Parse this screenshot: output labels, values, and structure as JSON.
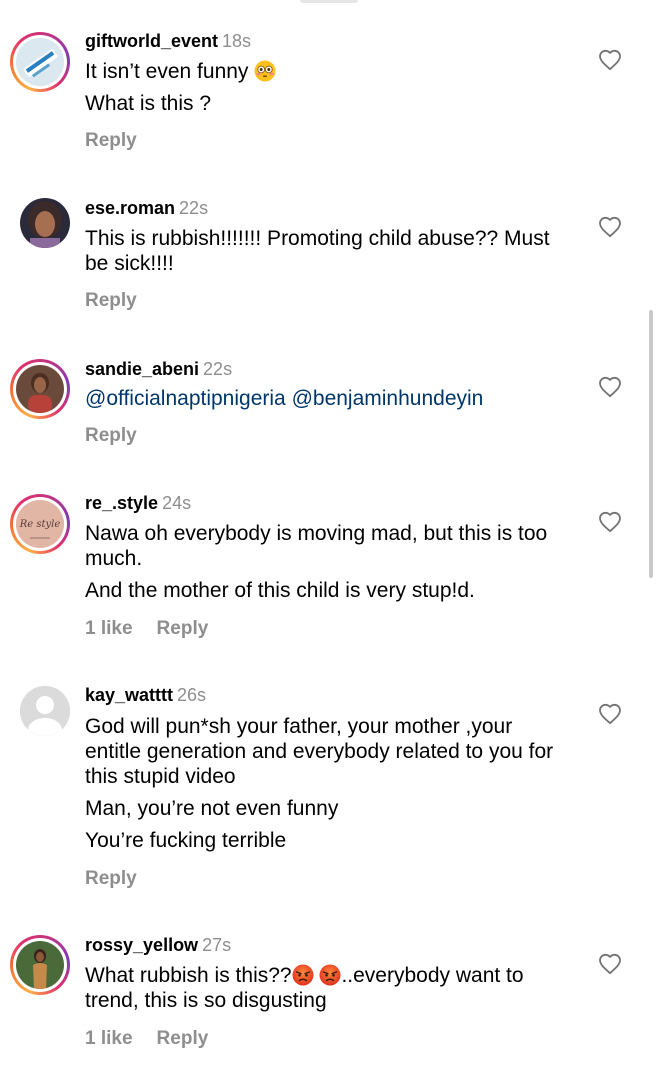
{
  "comments": [
    {
      "username": "giftworld_event",
      "time": "18s",
      "lines": [
        "It isn’t even funny",
        "What is this ?"
      ],
      "emoji": "flushed-face",
      "likes": "",
      "reply_label": "Reply"
    },
    {
      "username": "ese.roman",
      "time": "22s",
      "lines": [
        "This is rubbish!!!!!!! Promoting child abuse?? Must be sick!!!!"
      ],
      "likes": "",
      "reply_label": "Reply"
    },
    {
      "username": "sandie_abeni",
      "time": "22s",
      "mentions": [
        "@officialnaptipnigeria",
        "@benjaminhundeyin"
      ],
      "likes": "",
      "reply_label": "Reply"
    },
    {
      "username": "re_.style",
      "time": "24s",
      "lines": [
        "Nawa oh everybody is moving mad, but this is too much.",
        "And the mother of this child is very stup!d."
      ],
      "likes": "1 like",
      "reply_label": "Reply",
      "avatar_text": "Re style"
    },
    {
      "username": "kay_watttt",
      "time": "26s",
      "lines": [
        "God will pun*sh your father, your mother ,your entitle generation and everybody related to you for this stupid video",
        "Man, you’re not even funny",
        "You’re fucking terrible"
      ],
      "likes": "",
      "reply_label": "Reply"
    },
    {
      "username": "rossy_yellow",
      "time": "27s",
      "text_before": "What rubbish is this??",
      "emoji": "angry-face",
      "text_after": "..everybody want to trend, this is so disgusting",
      "likes": "1 like",
      "reply_label": "Reply"
    }
  ],
  "colors": {
    "username": "#000000",
    "secondary": "#8e8e8e",
    "mention": "#00376b",
    "story_ring": [
      "#fcaf45",
      "#e1306c",
      "#833ab4"
    ]
  },
  "icons": [
    "heart-outline-icon",
    "flushed-face-emoji",
    "angry-face-emoji"
  ]
}
